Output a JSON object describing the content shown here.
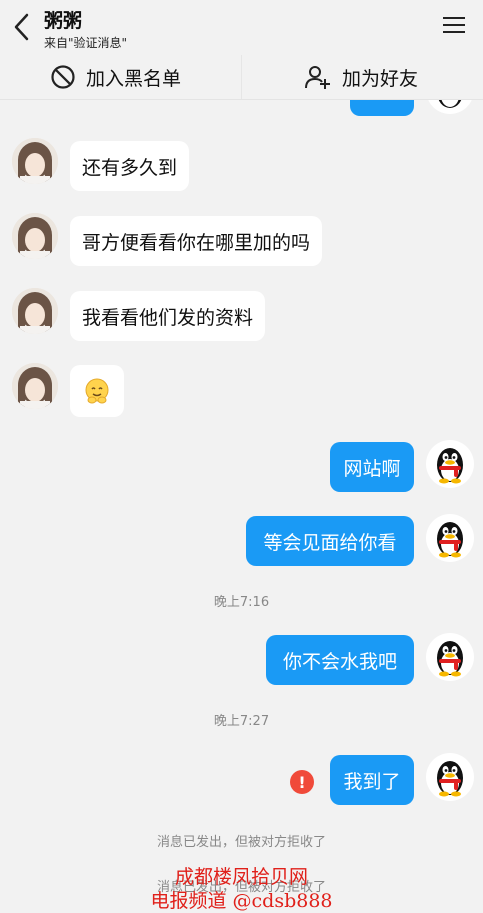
{
  "header": {
    "title": "粥粥",
    "subtitle": "来自\"验证消息\"",
    "block_label": "加入黑名单",
    "add_friend_label": "加为好友"
  },
  "messages": [
    {
      "side": "in",
      "text": "还有多久到"
    },
    {
      "side": "in",
      "text": "哥方便看看你在哪里加的吗"
    },
    {
      "side": "in",
      "text": "我看看他们发的资料"
    },
    {
      "side": "in",
      "text": "",
      "emoji": "smile-emoji"
    },
    {
      "side": "out",
      "text": "网站啊"
    },
    {
      "side": "out",
      "text": "等会见面给你看"
    },
    {
      "side": "out",
      "text": "你不会水我吧"
    },
    {
      "side": "out",
      "text": "我到了",
      "failed": true
    }
  ],
  "timestamps": [
    "晚上7:16",
    "晚上7:27"
  ],
  "system": {
    "rejected_1": "消息已发出，但被对方拒收了",
    "rejected_2": "消息已发出，但被对方拒收了"
  },
  "watermark": {
    "line1": "成都楼凤拾贝网",
    "line2": "电报频道 @cdsb888",
    "color": "#e0201a"
  },
  "colors": {
    "outgoing_bubble": "#1a9af5",
    "error": "#f04a3a"
  }
}
